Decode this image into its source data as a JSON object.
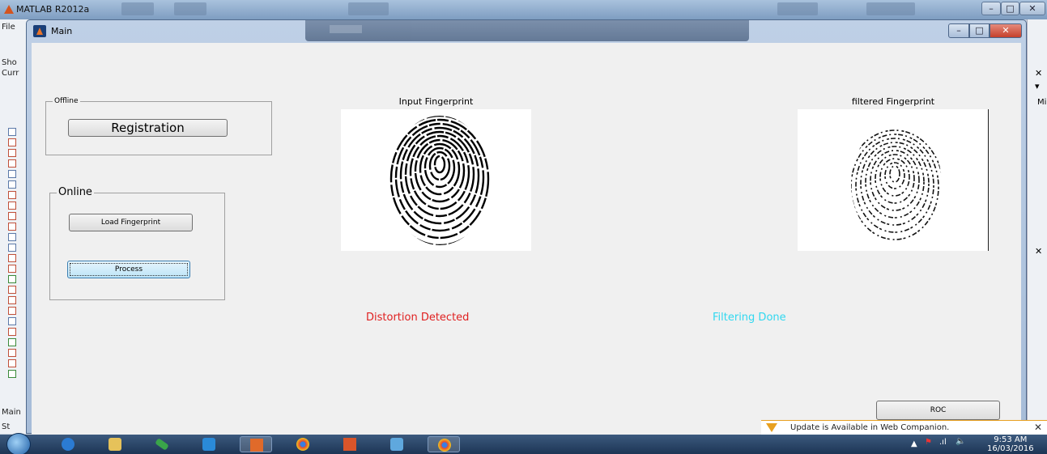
{
  "matlab": {
    "title": "MATLAB R2012a",
    "menu_file": "File",
    "left_labels": {
      "shortcuts": "Sho",
      "current": "Curr",
      "main": "Main",
      "start": "St"
    },
    "right_labels": {
      "mi": "Mi"
    }
  },
  "figure": {
    "title": "Main",
    "offline_panel": {
      "title": "Offline",
      "registration_button": "Registration"
    },
    "online_panel": {
      "title": "Online",
      "load_button": "Load Fingerprint",
      "process_button": "Process"
    },
    "input_axes_title": "Input Fingerprint",
    "filtered_axes_title": "filtered Fingerprint",
    "status_distortion": "Distortion Detected",
    "status_filtering": "Filtering Done",
    "roc_button": "ROC",
    "colors": {
      "distortion": "#e02020",
      "filtering": "#30d8f0"
    }
  },
  "notification": {
    "text": "Update is Available in Web Companion."
  },
  "taskbar": {
    "time": "9:53 AM",
    "date": "16/03/2016"
  },
  "icons": {
    "start": "windows-start-icon",
    "apps": [
      "ie-icon",
      "explorer-icon",
      "snipping-tool-icon",
      "teamviewer-icon",
      "matlab-icon",
      "chrome-icon",
      "matlab-icon",
      "photo-viewer-icon",
      "chrome-icon"
    ]
  }
}
